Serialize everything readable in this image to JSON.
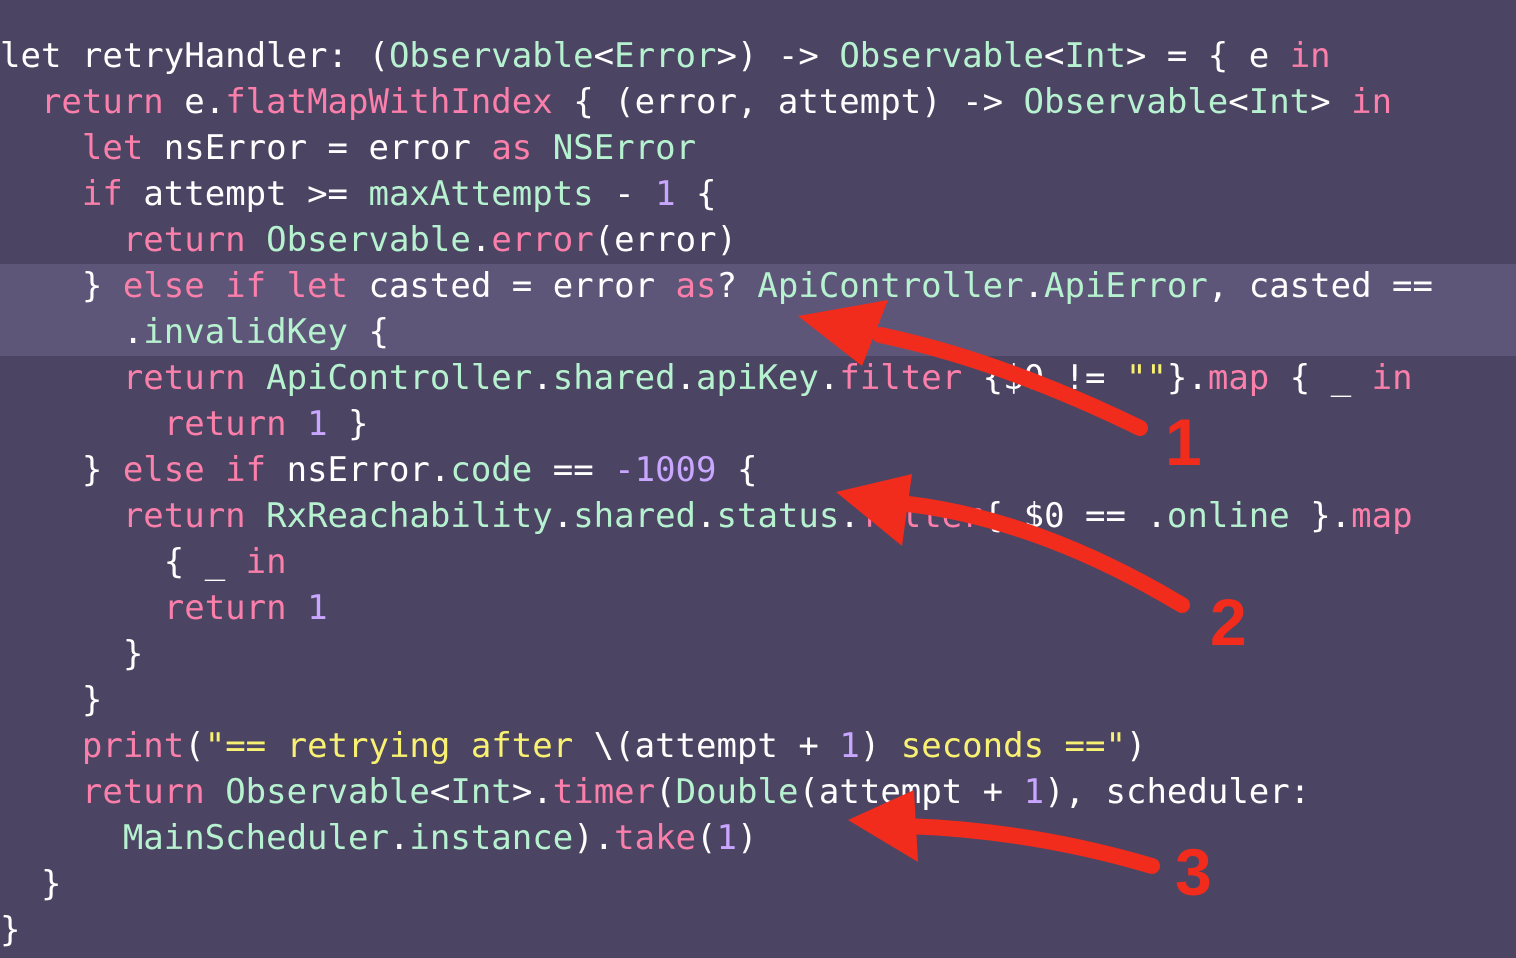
{
  "code": {
    "lines": [
      [
        [
          "p",
          "let retryHandler: ("
        ],
        [
          "t",
          "Observable"
        ],
        [
          "p",
          "<"
        ],
        [
          "t",
          "Error"
        ],
        [
          "p",
          ">) -> "
        ],
        [
          "t",
          "Observable"
        ],
        [
          "p",
          "<"
        ],
        [
          "t",
          "Int"
        ],
        [
          "p",
          "> = { e "
        ],
        [
          "k",
          "in"
        ]
      ],
      [
        [
          "p",
          "  "
        ],
        [
          "k",
          "return"
        ],
        [
          "p",
          " e."
        ],
        [
          "k",
          "flatMapWithIndex"
        ],
        [
          "p",
          " { (error, attempt) -> "
        ],
        [
          "t",
          "Observable"
        ],
        [
          "p",
          "<"
        ],
        [
          "t",
          "Int"
        ],
        [
          "p",
          "> "
        ],
        [
          "k",
          "in"
        ]
      ],
      [
        [
          "p",
          "    "
        ],
        [
          "k",
          "let"
        ],
        [
          "p",
          " nsError = error "
        ],
        [
          "k",
          "as"
        ],
        [
          "p",
          " "
        ],
        [
          "t",
          "NSError"
        ]
      ],
      [
        [
          "p",
          "    "
        ],
        [
          "k",
          "if"
        ],
        [
          "p",
          " attempt >= "
        ],
        [
          "t",
          "maxAttempts"
        ],
        [
          "p",
          " - "
        ],
        [
          "n",
          "1"
        ],
        [
          "p",
          " {"
        ]
      ],
      [
        [
          "p",
          "      "
        ],
        [
          "k",
          "return"
        ],
        [
          "p",
          " "
        ],
        [
          "t",
          "Observable"
        ],
        [
          "p",
          "."
        ],
        [
          "k",
          "error"
        ],
        [
          "p",
          "(error)"
        ]
      ],
      [
        [
          "p",
          "    } "
        ],
        [
          "k",
          "else if let"
        ],
        [
          "p",
          " casted = error "
        ],
        [
          "k",
          "as"
        ],
        [
          "p",
          "? "
        ],
        [
          "t",
          "ApiController"
        ],
        [
          "p",
          "."
        ],
        [
          "t",
          "ApiError"
        ],
        [
          "p",
          ", casted =="
        ]
      ],
      [
        [
          "p",
          "      ."
        ],
        [
          "t",
          "invalidKey"
        ],
        [
          "p",
          " {"
        ]
      ],
      [
        [
          "p",
          "      "
        ],
        [
          "k",
          "return"
        ],
        [
          "p",
          " "
        ],
        [
          "t",
          "ApiController"
        ],
        [
          "p",
          "."
        ],
        [
          "t",
          "shared"
        ],
        [
          "p",
          "."
        ],
        [
          "t",
          "apiKey"
        ],
        [
          "p",
          "."
        ],
        [
          "k",
          "filter"
        ],
        [
          "p",
          " {$0 != "
        ],
        [
          "s",
          "\"\""
        ],
        [
          "p",
          "}."
        ],
        [
          "k",
          "map"
        ],
        [
          "p",
          " { _ "
        ],
        [
          "k",
          "in"
        ]
      ],
      [
        [
          "p",
          "        "
        ],
        [
          "k",
          "return"
        ],
        [
          "p",
          " "
        ],
        [
          "n",
          "1"
        ],
        [
          "p",
          " }"
        ]
      ],
      [
        [
          "p",
          "    } "
        ],
        [
          "k",
          "else if"
        ],
        [
          "p",
          " nsError."
        ],
        [
          "t",
          "code"
        ],
        [
          "p",
          " == "
        ],
        [
          "n",
          "-1009"
        ],
        [
          "p",
          " {"
        ]
      ],
      [
        [
          "p",
          "      "
        ],
        [
          "k",
          "return"
        ],
        [
          "p",
          " "
        ],
        [
          "t",
          "RxReachability"
        ],
        [
          "p",
          "."
        ],
        [
          "t",
          "shared"
        ],
        [
          "p",
          "."
        ],
        [
          "t",
          "status"
        ],
        [
          "p",
          "."
        ],
        [
          "k",
          "filter"
        ],
        [
          "p",
          "{ $0 == ."
        ],
        [
          "t",
          "online"
        ],
        [
          "p",
          " }."
        ],
        [
          "k",
          "map"
        ]
      ],
      [
        [
          "p",
          "        { _ "
        ],
        [
          "k",
          "in"
        ]
      ],
      [
        [
          "p",
          "        "
        ],
        [
          "k",
          "return"
        ],
        [
          "p",
          " "
        ],
        [
          "n",
          "1"
        ]
      ],
      [
        [
          "p",
          "      }"
        ]
      ],
      [
        [
          "p",
          "    }"
        ]
      ],
      [
        [
          "p",
          "    "
        ],
        [
          "k",
          "print"
        ],
        [
          "p",
          "("
        ],
        [
          "s",
          "\"== retrying after "
        ],
        [
          "p",
          "\\(attempt + "
        ],
        [
          "n",
          "1"
        ],
        [
          "p",
          ") "
        ],
        [
          "s",
          "seconds ==\""
        ],
        [
          "p",
          ")"
        ]
      ],
      [
        [
          "p",
          "    "
        ],
        [
          "k",
          "return"
        ],
        [
          "p",
          " "
        ],
        [
          "t",
          "Observable"
        ],
        [
          "p",
          "<"
        ],
        [
          "t",
          "Int"
        ],
        [
          "p",
          ">."
        ],
        [
          "k",
          "timer"
        ],
        [
          "p",
          "("
        ],
        [
          "t",
          "Double"
        ],
        [
          "p",
          "(attempt + "
        ],
        [
          "n",
          "1"
        ],
        [
          "p",
          "), scheduler:"
        ]
      ],
      [
        [
          "p",
          "      "
        ],
        [
          "t",
          "MainScheduler"
        ],
        [
          "p",
          "."
        ],
        [
          "t",
          "instance"
        ],
        [
          "p",
          ")."
        ],
        [
          "k",
          "take"
        ],
        [
          "p",
          "("
        ],
        [
          "n",
          "1"
        ],
        [
          "p",
          ")"
        ]
      ],
      [
        [
          "p",
          "  }"
        ]
      ],
      [
        [
          "p",
          "}"
        ]
      ]
    ]
  },
  "annotations": [
    {
      "label": "1"
    },
    {
      "label": "2"
    },
    {
      "label": "3"
    }
  ],
  "colors": {
    "background": "#4b4462",
    "highlight": "#5d5679",
    "plain": "#ffffff",
    "keyword": "#fa7faa",
    "type": "#b7f2d0",
    "number": "#c9a6ff",
    "string": "#f9f171",
    "arrow": "#f22c1c"
  }
}
